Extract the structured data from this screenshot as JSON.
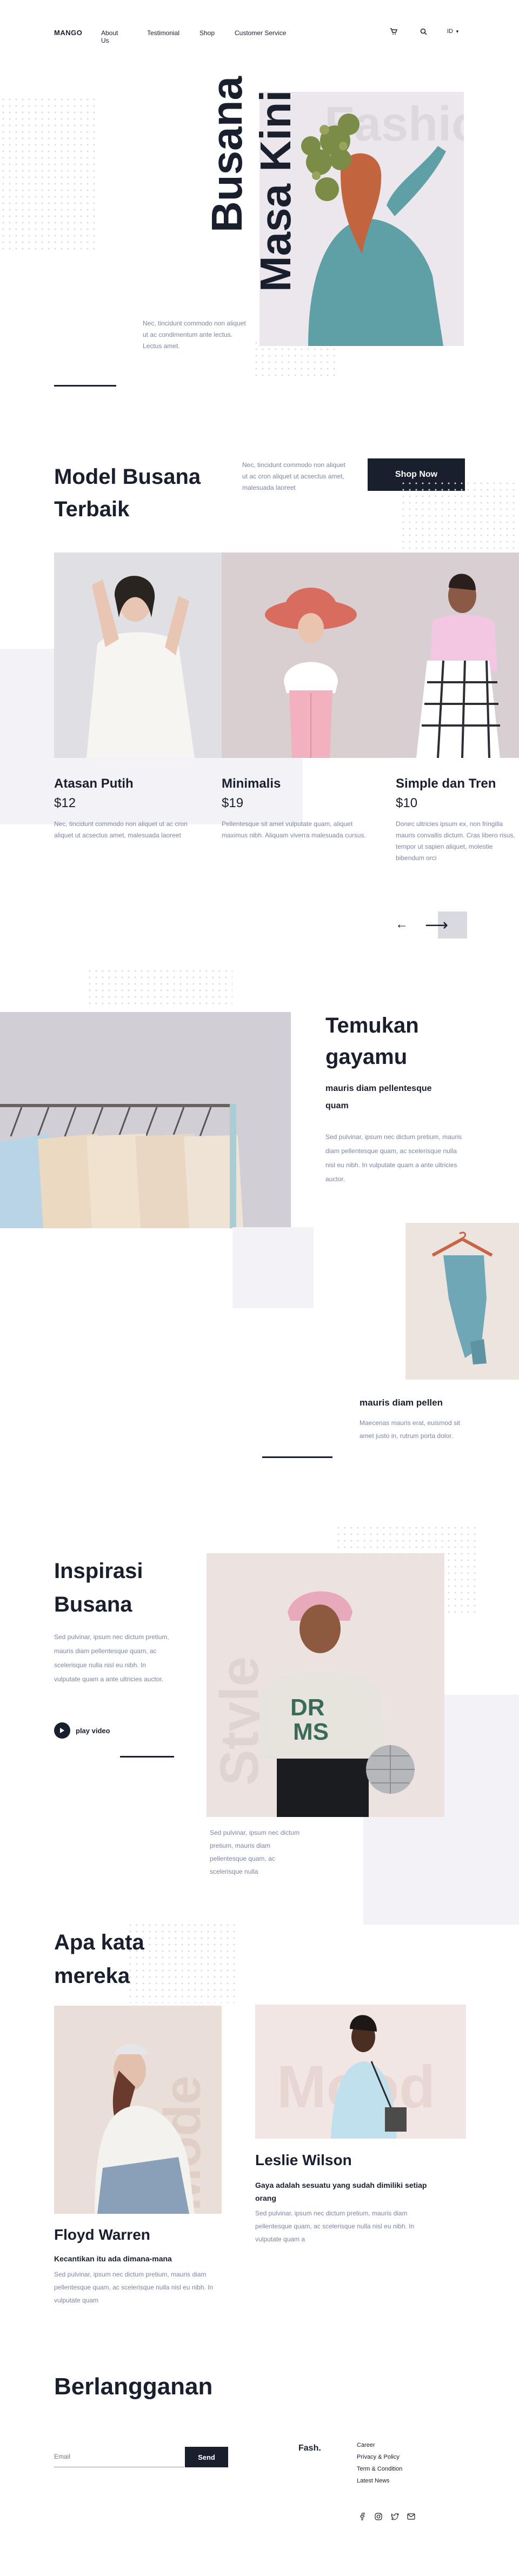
{
  "nav": {
    "logo": "MANGO",
    "links": [
      "About Us",
      "Testimonial",
      "Shop",
      "Customer Service"
    ],
    "language": "ID"
  },
  "hero": {
    "title_line1": "Busana",
    "title_line2": "Masa Kini",
    "watermark": "Fashion",
    "description": "Nec, tincidunt commodo non aliquet ut ac condimentum ante lectus. Lectus amet."
  },
  "models": {
    "title": "Model Busana Terbaik",
    "description": "Nec, tincidunt commodo non aliquet ut ac cron aliquet ut acsectus amet, malesuada laoreet",
    "shop_button": "Shop Now",
    "products": [
      {
        "name": "Atasan Putih",
        "price": "$12",
        "desc": "Nec, tincidunt commodo non aliquet ut ac cron aliquet ut acsectus amet, malesuada laoreet"
      },
      {
        "name": "Minimalis",
        "price": "$19",
        "desc": "Pellentesque sit amet vulputate quam, aliquet maximus nibh. Aliquam viverra malesuada cursus."
      },
      {
        "name": "Simple dan Tren",
        "price": "$10",
        "desc": "Donec ultricies ipsum ex, non fringilla mauris convallis dictum. Cras libero risus, tempor ut sapien aliquet, molestie bibendum orci"
      }
    ],
    "prev_arrow": "←",
    "next_arrow": "⟶"
  },
  "temukan": {
    "title": "Temukan gayamu",
    "subtitle": "mauris diam pellentesque quam",
    "description": "Sed pulvinar, ipsum nec dictum pretium, mauris diam pellentesque quam, ac scelerisque nulla nisl eu nibh. In vulputate quam a ante ultricies auctor.",
    "item_title": "mauris diam pellen",
    "item_desc": "Maecenas mauris erat, euismod sit amet justo in, rutrum porta dolor."
  },
  "inspirasi": {
    "title": "Inspirasi Busana",
    "description": "Sed pulvinar, ipsum nec dictum pretium, mauris diam pellentesque quam, ac scelerisque nulla nisl eu nibh. In vulputate quam a ante ultricies auctor.",
    "play_label": "play video",
    "watermark": "Style",
    "caption": "Sed pulvinar, ipsum nec dictum pretium, mauris diam pellentesque quam, ac scelerisque nulla"
  },
  "testimonial": {
    "title": "Apa kata mereka",
    "person1": {
      "name": "Floyd Warren",
      "quote": "Kecantikan itu ada dimana-mana",
      "desc": "Sed pulvinar, ipsum nec dictum pretium, mauris diam pellentesque quam, ac scelerisque nulla nisl eu nibh. In vulputate quam",
      "watermark": "Mode"
    },
    "person2": {
      "name": "Leslie Wilson",
      "quote": "Gaya adalah sesuatu yang sudah dimiliki setiap orang",
      "desc": "Sed pulvinar, ipsum nec dictum pretium, mauris diam pellentesque quam, ac scelerisque nulla nisl eu nibh. In vulputate quam a",
      "watermark": "Mood"
    }
  },
  "subscribe": {
    "title": "Berlangganan",
    "placeholder": "Email",
    "button": "Send"
  },
  "footer": {
    "brand": "Fash.",
    "links": [
      "Career",
      "Privacy & Policy",
      "Term & Condition",
      "Latest News"
    ]
  },
  "colors": {
    "navy": "#1a1f2e",
    "muted": "#7c86a2",
    "pale": "#f3f3f7"
  }
}
